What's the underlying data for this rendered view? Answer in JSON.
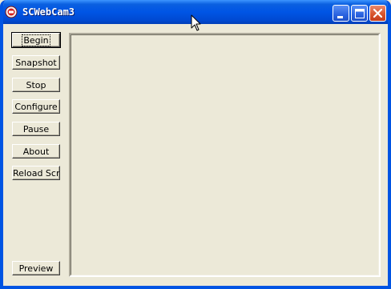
{
  "window": {
    "title": "SCWebCam3"
  },
  "buttons": {
    "begin": "Begin",
    "snapshot": "Snapshot",
    "stop": "Stop",
    "configure": "Configure",
    "pause": "Pause",
    "about": "About",
    "reload": "Reload Scr",
    "preview": "Preview"
  },
  "icons": {
    "app": "webcam-app-icon",
    "minimize": "minimize-icon",
    "maximize": "maximize-icon",
    "close": "close-icon",
    "cursor": "mouse-pointer-icon"
  },
  "colors": {
    "titlebar": "#0055e5",
    "client_bg": "#ece9d8",
    "close_button": "#d8552c"
  }
}
